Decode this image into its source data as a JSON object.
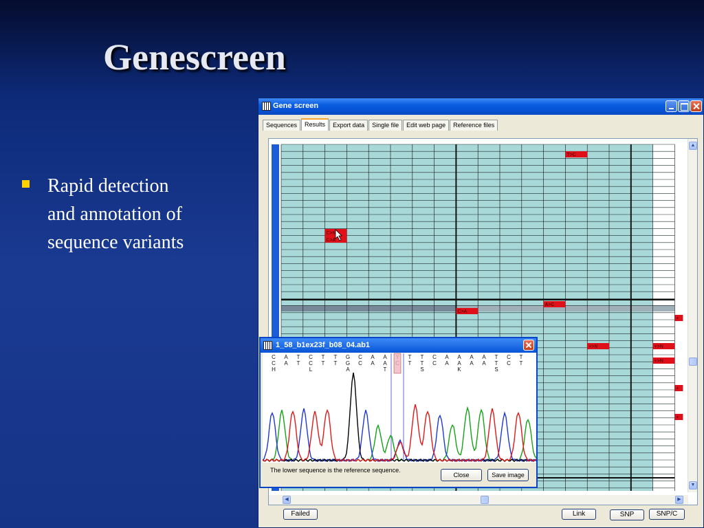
{
  "slide": {
    "title": "Genescreen",
    "bullet": "Rapid detection and annotation of sequence variants"
  },
  "window": {
    "title": "Gene screen",
    "tabs": [
      {
        "label": "Sequences",
        "active": false
      },
      {
        "label": "Results",
        "active": true
      },
      {
        "label": "Export data",
        "active": false
      },
      {
        "label": "Single file",
        "active": false
      },
      {
        "label": "Edit web page",
        "active": false
      },
      {
        "label": "Reference files",
        "active": false
      }
    ],
    "variant_labels": {
      "t_to_c": "T>C",
      "a_to_c": "A>C",
      "c_to_a": "C>A",
      "ins_n_1": "+>N",
      "ins_n_2": "+>N",
      "ins_n_3": "+>N",
      "plus_1": "+",
      "plus_2": "+",
      "plus_3": "+",
      "cursor_cell_top": "C>N",
      "cursor_cell_bottom": "C>A"
    },
    "buttons": {
      "failed": "Failed",
      "link": "Link",
      "snp": "SNP",
      "snp_c": "SNP/C"
    }
  },
  "popup": {
    "title": "1_58_b1ex23f_b08_04.ab1",
    "upper_sequence": [
      "C",
      "A",
      "T",
      "C",
      "T",
      "T",
      "G",
      "C",
      "A",
      "A",
      "Y",
      "T",
      "T",
      "C",
      "A",
      "A",
      "A",
      "A",
      "T",
      "C",
      "T"
    ],
    "lower_sequence": [
      "C",
      "A",
      "T",
      "C",
      "T",
      "T",
      "G",
      "C",
      "A",
      "A",
      "C",
      "T",
      "T",
      "C",
      "A",
      "A",
      "A",
      "A",
      "T",
      "C",
      "T"
    ],
    "third_row": [
      "H",
      "",
      "",
      "L",
      "",
      "",
      "A",
      "",
      "",
      "T",
      "",
      "",
      "S",
      "",
      "",
      "K",
      "",
      "",
      "S",
      "",
      ""
    ],
    "note": "The lower sequence is the reference sequence.",
    "close_label": "Close",
    "save_label": "Save image"
  },
  "colors": {
    "grid_cell": "#a9d8d8",
    "variant_cell": "#e0101a",
    "trace_A": "#13a313",
    "trace_C": "#1d36d6",
    "trace_G": "#000000",
    "trace_T": "#e01818"
  }
}
